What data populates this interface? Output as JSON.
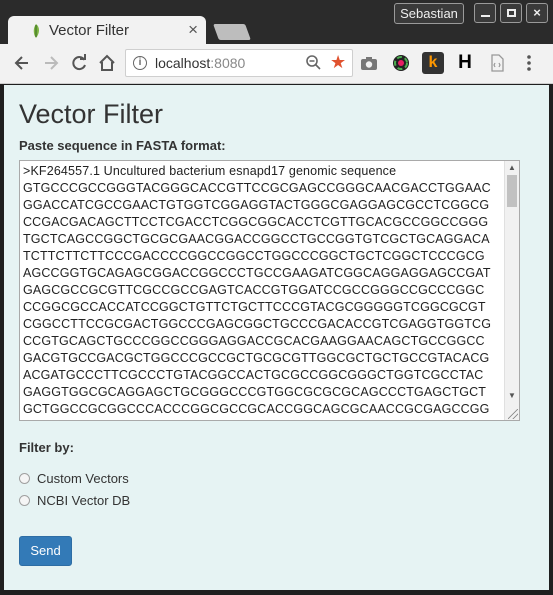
{
  "window": {
    "tab_title": "Vector Filter",
    "tab_close": "×",
    "user": "Sebastian",
    "close_glyph": "×"
  },
  "toolbar": {
    "url_host": "localhost",
    "url_port": ":8080",
    "icons": [
      "back-icon",
      "forward-icon",
      "reload-icon",
      "home-icon",
      "info-icon",
      "zoom-icon",
      "bookmark-star-icon",
      "camera-icon",
      "color-wheel-icon",
      "k-extension-icon",
      "h-extension-icon",
      "document-extension-icon",
      "menu-icon"
    ],
    "ext_k": "k",
    "ext_h": "H"
  },
  "page": {
    "title": "Vector Filter",
    "fasta_label": "Paste sequence in FASTA format:",
    "fasta_lines": [
      ">KF264557.1 Uncultured bacterium esnapd17 genomic sequence",
      "GTGCCCGCCGGGTACGGGCACCGTTCCGCGAGCCGGGCAACGACCTGGAAC",
      "GGACCATCGCCGAACTGTGGTCGGAGGTACTGGGCGAGGAGCGCCTCGGCG",
      "CCGACGACAGCTTCCTCGACCTCGGCGGCACCTCGTTGCACGCCGGCCGGG",
      "TGCTCAGCCGGCTGCGCGAACGGACCGGCCTGCCGGTGTCGCTGCAGGACA",
      "TCTTCTTCTTCCCGACCCCGGCCGGCCTGGCCCGGCTGCTCGGCTCCCGCG",
      "AGCCGGTGCAGAGCGGACCGGCCCTGCCGAAGATCGGCAGGAGGAGCCGAT",
      "GAGCGCCGCGTTCGCCGCCGAGTCACCGTGGATCCGCCGGGCCGCCCGGC",
      "CCGGCGCCACCATCCGGCTGTTCTGCTTCCCGTACGCGGGGGTCGGCGCGT",
      "CGGCCTTCCGCGACTGGCCCGAGCGGCTGCCCGACACCGTCGAGGTGGTCG",
      "CCGTGCAGCTGCCCGGCCGGGAGGACCGCACGAAGGAACAGCTGCCGGCC",
      "GACGTGCCGACGCTGGCCCGCCGCTGCGCGTTGGCGCTGCTGCCGTACACG",
      "ACGATGCCCTTCGCCCTGTACGGCCACTGCGCCGGCGGGCTGGTCGCCTAC",
      "GAGGTGGCGCAGGAGCTGCGGGCCCGTGGCGCGCGCAGCCCTGAGCTGCT",
      "GCTGGCCGCGGCCCACCCGGCGCCGCACCGGCAGCGCAACCGCGAGCCGG"
    ],
    "filter_label": "Filter by:",
    "options": [
      "Custom Vectors",
      "NCBI Vector DB"
    ],
    "send_label": "Send"
  },
  "colors": {
    "page_background": "#e6f3f3",
    "button_primary": "#337ab7",
    "star_accent": "#e0522f"
  }
}
